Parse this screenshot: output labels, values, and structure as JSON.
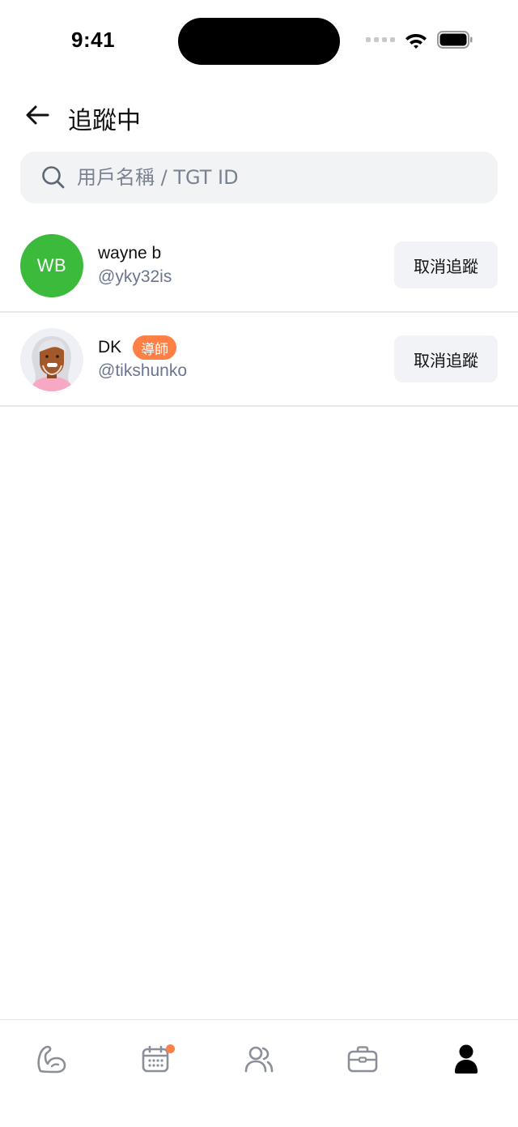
{
  "status_bar": {
    "time": "9:41"
  },
  "header": {
    "title": "追蹤中",
    "back_icon": "arrow-left-icon"
  },
  "search": {
    "placeholder": "用戶名稱 / TGT ID",
    "value": ""
  },
  "following": [
    {
      "avatar_type": "initials",
      "initials": "WB",
      "avatar_color": "#3cba3c",
      "name": "wayne b",
      "handle": "@yky32is",
      "badge": "",
      "action_label": "取消追蹤"
    },
    {
      "avatar_type": "photo",
      "initials": "",
      "name": "DK",
      "handle": "@tikshunko",
      "badge": "導師",
      "action_label": "取消追蹤"
    }
  ],
  "bottom_nav": {
    "items": [
      {
        "icon": "flexed-arm-icon",
        "active": false,
        "has_dot": false
      },
      {
        "icon": "calendar-icon",
        "active": false,
        "has_dot": true
      },
      {
        "icon": "users-icon",
        "active": false,
        "has_dot": false
      },
      {
        "icon": "briefcase-icon",
        "active": false,
        "has_dot": false
      },
      {
        "icon": "profile-icon",
        "active": true,
        "has_dot": false
      }
    ]
  },
  "colors": {
    "badge": "#ff7f45",
    "handle": "#6b7590",
    "nav_inactive": "#8a8f99",
    "nav_active": "#000000"
  }
}
